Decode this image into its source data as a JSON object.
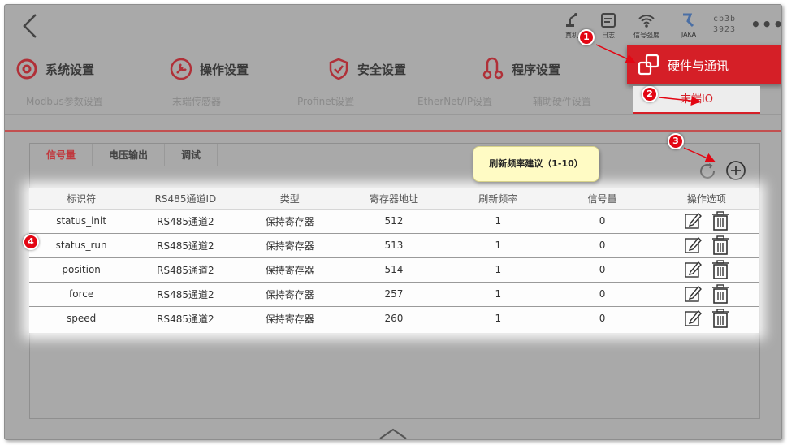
{
  "topbar": {
    "icons": [
      {
        "name": "robot-icon",
        "label": "真机"
      },
      {
        "name": "log-icon",
        "label": "日志"
      },
      {
        "name": "signal-icon",
        "label": "信号强度"
      },
      {
        "name": "jaka-logo-icon",
        "label": "JAKA"
      }
    ],
    "device_id_line1": "cb3b",
    "device_id_line2": "3923",
    "more": "•••"
  },
  "main_tabs": [
    {
      "label": "系统设置",
      "icon": "gear-icon"
    },
    {
      "label": "操作设置",
      "icon": "wrench-icon"
    },
    {
      "label": "安全设置",
      "icon": "shield-check-icon"
    },
    {
      "label": "程序设置",
      "icon": "program-icon"
    },
    {
      "label": "硬件与通讯",
      "icon": "hardware-icon",
      "active": true
    }
  ],
  "sub_tabs": [
    {
      "label": "Modbus参数设置"
    },
    {
      "label": "末端传感器"
    },
    {
      "label": "Profinet设置"
    },
    {
      "label": "EtherNet/IP设置"
    },
    {
      "label": "辅助硬件设置"
    },
    {
      "label": "末端IO",
      "active": true
    }
  ],
  "inner_tabs": [
    {
      "label": "信号量",
      "active": true
    },
    {
      "label": "电压输出"
    },
    {
      "label": "调试"
    }
  ],
  "tooltip": "刷新频率建议（1-10）",
  "table": {
    "headers": [
      "标识符",
      "RS485通道ID",
      "类型",
      "寄存器地址",
      "刷新频率",
      "信号量",
      "操作选项"
    ],
    "rows": [
      {
        "id": "status_init",
        "channel": "RS485通道2",
        "type": "保持寄存器",
        "addr": "512",
        "freq": "1",
        "signal": "0"
      },
      {
        "id": "status_run",
        "channel": "RS485通道2",
        "type": "保持寄存器",
        "addr": "513",
        "freq": "1",
        "signal": "0"
      },
      {
        "id": "position",
        "channel": "RS485通道2",
        "type": "保持寄存器",
        "addr": "514",
        "freq": "1",
        "signal": "0"
      },
      {
        "id": "force",
        "channel": "RS485通道2",
        "type": "保持寄存器",
        "addr": "257",
        "freq": "1",
        "signal": "0"
      },
      {
        "id": "speed",
        "channel": "RS485通道2",
        "type": "保持寄存器",
        "addr": "260",
        "freq": "1",
        "signal": "0"
      }
    ]
  },
  "markers": [
    "1",
    "2",
    "3",
    "4"
  ],
  "colors": {
    "accent": "#d51f27",
    "marker": "#e30613",
    "tooltip_bg": "#fffbc4"
  }
}
